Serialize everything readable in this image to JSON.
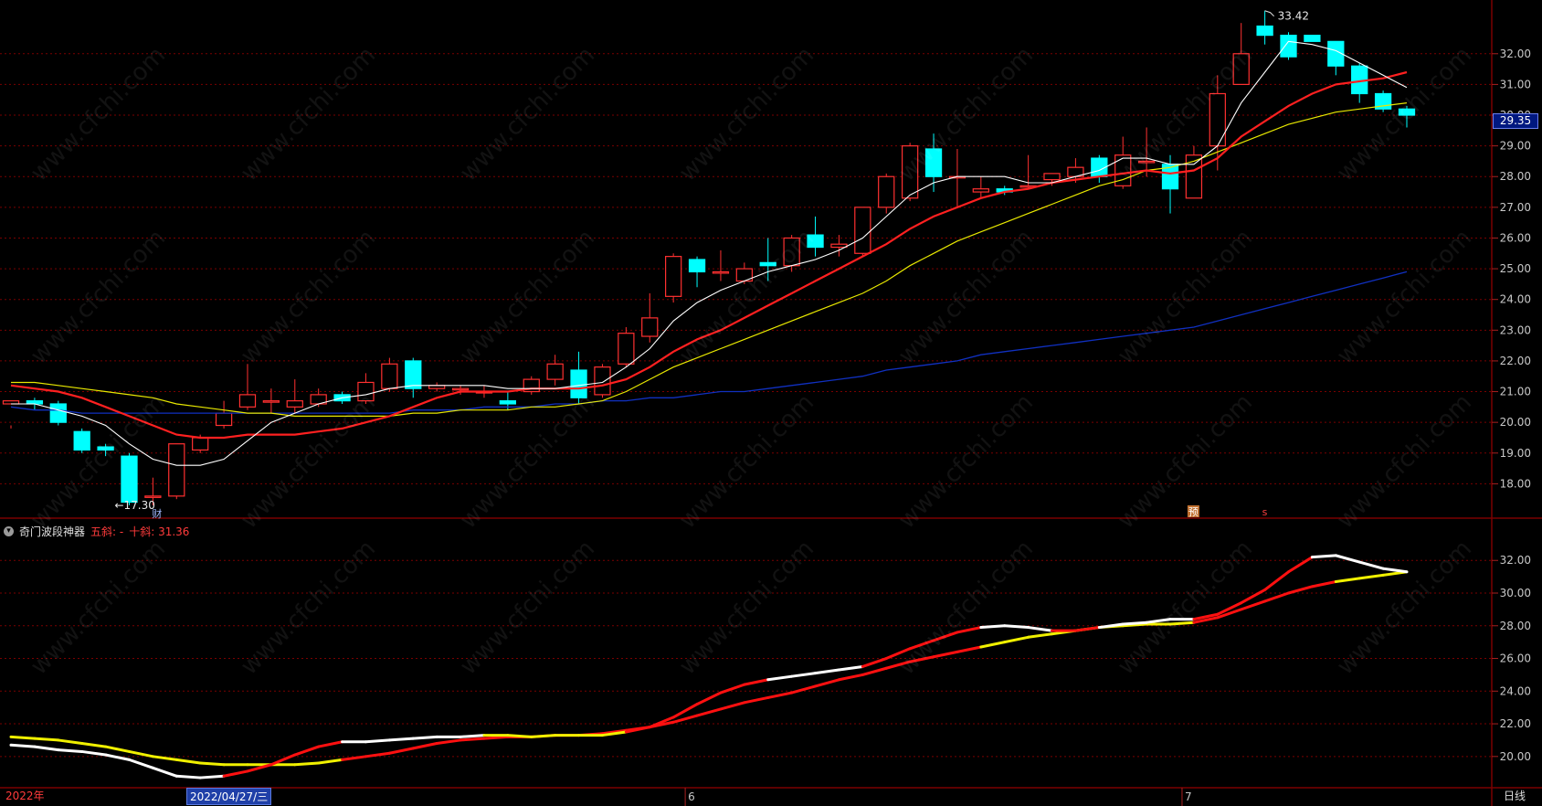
{
  "indicator": {
    "name": "奇门波段神器",
    "fast_label": "五斜: -",
    "slow_label": "十斜: 31.36"
  },
  "bottom_axis": {
    "start_label": "2022年",
    "cursor_date": "2022/04/27/三",
    "month_labels": [
      "6",
      "7"
    ],
    "period": "日线"
  },
  "current_price": "29.35",
  "watermark_text": "www.cfchi.com",
  "colors": {
    "up": "#ff3030",
    "down": "#00ffff",
    "ma5": "#ffffff",
    "ma10": "#ff2020",
    "ma20": "#e8e800",
    "ma60": "#1030c0",
    "grid": "#7a0000"
  },
  "chart_data": [
    {
      "type": "candlestick",
      "yticks": [
        "32.00",
        "31.00",
        "30.00",
        "29.00",
        "28.00",
        "27.00",
        "26.00",
        "25.00",
        "24.00",
        "23.00",
        "22.00",
        "21.00",
        "20.00",
        "19.00",
        "18.00"
      ],
      "ylim": [
        17.0,
        33.6
      ],
      "annotations": {
        "high_label": "33.42",
        "low_label": "17.30",
        "marker_cai": "财",
        "marker_yu": "预",
        "marker_s": "s"
      },
      "candles": [
        [
          20.6,
          20.7,
          19.8,
          19.9
        ],
        [
          20.7,
          20.6,
          20.4,
          20.8
        ],
        [
          20.6,
          20.0,
          19.9,
          20.7
        ],
        [
          19.7,
          19.1,
          19.0,
          19.8
        ],
        [
          19.2,
          19.1,
          18.9,
          19.3
        ],
        [
          18.9,
          17.4,
          17.3,
          19.0
        ],
        [
          17.6,
          17.6,
          17.3,
          18.2
        ],
        [
          17.6,
          19.3,
          17.5,
          19.3
        ],
        [
          19.1,
          19.5,
          19.0,
          19.6
        ],
        [
          19.9,
          20.3,
          19.8,
          20.7
        ],
        [
          20.5,
          20.9,
          20.4,
          21.9
        ],
        [
          20.7,
          20.7,
          20.3,
          21.1
        ],
        [
          20.5,
          20.7,
          20.3,
          21.4
        ],
        [
          20.6,
          20.9,
          20.5,
          21.1
        ],
        [
          20.9,
          20.7,
          20.6,
          21.0
        ],
        [
          20.7,
          21.3,
          20.6,
          21.6
        ],
        [
          21.1,
          21.9,
          21.0,
          22.1
        ],
        [
          22.0,
          21.1,
          20.8,
          22.1
        ],
        [
          21.1,
          21.2,
          21.0,
          21.3
        ],
        [
          21.1,
          21.1,
          20.9,
          21.2
        ],
        [
          21.0,
          21.0,
          20.8,
          21.2
        ],
        [
          20.7,
          20.6,
          20.4,
          21.0
        ],
        [
          21.0,
          21.4,
          20.9,
          21.5
        ],
        [
          21.4,
          21.9,
          21.2,
          22.2
        ],
        [
          21.7,
          20.8,
          20.6,
          22.3
        ],
        [
          20.9,
          21.8,
          20.8,
          21.9
        ],
        [
          21.9,
          22.9,
          21.8,
          23.1
        ],
        [
          22.8,
          23.4,
          22.6,
          24.2
        ],
        [
          24.1,
          25.4,
          23.9,
          25.5
        ],
        [
          25.3,
          24.9,
          24.4,
          25.4
        ],
        [
          24.9,
          24.9,
          24.6,
          25.6
        ],
        [
          24.6,
          25.0,
          24.5,
          25.2
        ],
        [
          25.2,
          25.1,
          24.6,
          26.0
        ],
        [
          25.1,
          26.0,
          24.9,
          26.1
        ],
        [
          26.1,
          25.7,
          25.4,
          26.7
        ],
        [
          25.7,
          25.8,
          25.4,
          26.1
        ],
        [
          25.5,
          27.0,
          25.4,
          27.0
        ],
        [
          27.0,
          28.0,
          26.8,
          28.1
        ],
        [
          27.3,
          29.0,
          27.2,
          29.1
        ],
        [
          28.9,
          28.0,
          27.5,
          29.4
        ],
        [
          28.0,
          28.0,
          27.0,
          28.9
        ],
        [
          27.5,
          27.6,
          27.3,
          28.0
        ],
        [
          27.6,
          27.5,
          27.4,
          27.7
        ],
        [
          27.7,
          27.7,
          27.6,
          28.7
        ],
        [
          27.9,
          28.1,
          27.7,
          28.1
        ],
        [
          28.0,
          28.3,
          27.8,
          28.6
        ],
        [
          28.6,
          28.0,
          27.8,
          28.7
        ],
        [
          27.7,
          28.7,
          27.6,
          29.3
        ],
        [
          28.5,
          28.5,
          28.0,
          29.6
        ],
        [
          28.4,
          27.6,
          26.8,
          28.7
        ],
        [
          27.3,
          28.7,
          27.3,
          29.0
        ],
        [
          29.0,
          30.7,
          28.2,
          31.3
        ],
        [
          31.0,
          32.0,
          31.2,
          33.0
        ],
        [
          32.9,
          32.6,
          32.3,
          33.4
        ],
        [
          32.6,
          31.9,
          31.8,
          32.7
        ],
        [
          32.6,
          32.4,
          32.4,
          32.6
        ],
        [
          32.4,
          31.6,
          31.3,
          32.4
        ],
        [
          31.6,
          30.7,
          30.4,
          31.7
        ],
        [
          30.7,
          30.2,
          30.1,
          30.8
        ],
        [
          30.2,
          30.0,
          29.6,
          30.3
        ]
      ],
      "ma5": [
        20.6,
        20.6,
        20.4,
        20.2,
        19.9,
        19.3,
        18.8,
        18.6,
        18.6,
        18.8,
        19.4,
        20.0,
        20.3,
        20.6,
        20.8,
        20.9,
        21.1,
        21.2,
        21.2,
        21.2,
        21.2,
        21.1,
        21.1,
        21.1,
        21.2,
        21.3,
        21.8,
        22.4,
        23.3,
        23.9,
        24.3,
        24.6,
        24.9,
        25.1,
        25.3,
        25.6,
        26.0,
        26.7,
        27.4,
        27.8,
        28.0,
        28.0,
        28.0,
        27.8,
        27.8,
        28.0,
        28.2,
        28.6,
        28.6,
        28.4,
        28.4,
        29.0,
        30.4,
        31.4,
        32.4,
        32.3,
        32.1,
        31.7,
        31.3,
        30.9
      ],
      "ma10": [
        21.2,
        21.1,
        21.0,
        20.8,
        20.5,
        20.2,
        19.9,
        19.6,
        19.5,
        19.5,
        19.6,
        19.6,
        19.6,
        19.7,
        19.8,
        20.0,
        20.2,
        20.5,
        20.8,
        21.0,
        21.0,
        21.0,
        21.1,
        21.1,
        21.1,
        21.2,
        21.4,
        21.8,
        22.3,
        22.7,
        23.0,
        23.4,
        23.8,
        24.2,
        24.6,
        25.0,
        25.4,
        25.8,
        26.3,
        26.7,
        27.0,
        27.3,
        27.5,
        27.6,
        27.8,
        27.9,
        28.0,
        28.1,
        28.2,
        28.1,
        28.2,
        28.6,
        29.3,
        29.8,
        30.3,
        30.7,
        31.0,
        31.1,
        31.2,
        31.4
      ],
      "ma20": [
        21.3,
        21.3,
        21.2,
        21.1,
        21.0,
        20.9,
        20.8,
        20.6,
        20.5,
        20.4,
        20.3,
        20.3,
        20.2,
        20.2,
        20.2,
        20.2,
        20.2,
        20.3,
        20.3,
        20.4,
        20.4,
        20.4,
        20.5,
        20.5,
        20.6,
        20.7,
        21.0,
        21.4,
        21.8,
        22.1,
        22.4,
        22.7,
        23.0,
        23.3,
        23.6,
        23.9,
        24.2,
        24.6,
        25.1,
        25.5,
        25.9,
        26.2,
        26.5,
        26.8,
        27.1,
        27.4,
        27.7,
        27.9,
        28.2,
        28.3,
        28.5,
        28.8,
        29.1,
        29.4,
        29.7,
        29.9,
        30.1,
        30.2,
        30.3,
        30.4
      ],
      "ma60": [
        20.5,
        20.4,
        20.4,
        20.3,
        20.3,
        20.3,
        20.3,
        20.3,
        20.3,
        20.3,
        20.3,
        20.3,
        20.3,
        20.3,
        20.3,
        20.3,
        20.3,
        20.4,
        20.4,
        20.4,
        20.5,
        20.5,
        20.5,
        20.6,
        20.6,
        20.7,
        20.7,
        20.8,
        20.8,
        20.9,
        21.0,
        21.0,
        21.1,
        21.2,
        21.3,
        21.4,
        21.5,
        21.7,
        21.8,
        21.9,
        22.0,
        22.2,
        22.3,
        22.4,
        22.5,
        22.6,
        22.7,
        22.8,
        22.9,
        23.0,
        23.1,
        23.3,
        23.5,
        23.7,
        23.9,
        24.1,
        24.3,
        24.5,
        24.7,
        24.9
      ]
    },
    {
      "type": "line",
      "name": "奇门波段神器",
      "yticks": [
        "32.00",
        "30.00",
        "28.00",
        "26.00",
        "24.00",
        "22.00",
        "20.00"
      ],
      "ylim": [
        18.2,
        33.3
      ],
      "fast": [
        20.7,
        20.6,
        20.4,
        20.3,
        20.1,
        19.8,
        19.3,
        18.8,
        18.7,
        18.8,
        19.1,
        19.5,
        20.1,
        20.6,
        20.9,
        20.9,
        21.0,
        21.1,
        21.2,
        21.2,
        21.3,
        21.3,
        21.2,
        21.3,
        21.3,
        21.3,
        21.5,
        21.8,
        22.4,
        23.2,
        23.9,
        24.4,
        24.7,
        24.9,
        25.1,
        25.3,
        25.5,
        26.0,
        26.6,
        27.1,
        27.6,
        27.9,
        28.0,
        27.9,
        27.7,
        27.7,
        27.9,
        28.1,
        28.2,
        28.4,
        28.4,
        28.7,
        29.4,
        30.2,
        31.3,
        32.2,
        32.3,
        31.9,
        31.5,
        31.3
      ],
      "slow": [
        21.2,
        21.1,
        21.0,
        20.8,
        20.6,
        20.3,
        20.0,
        19.8,
        19.6,
        19.5,
        19.5,
        19.5,
        19.5,
        19.6,
        19.8,
        20.0,
        20.2,
        20.5,
        20.8,
        21.0,
        21.1,
        21.2,
        21.2,
        21.3,
        21.3,
        21.4,
        21.6,
        21.8,
        22.1,
        22.5,
        22.9,
        23.3,
        23.6,
        23.9,
        24.3,
        24.7,
        25.0,
        25.4,
        25.8,
        26.1,
        26.4,
        26.7,
        27.0,
        27.3,
        27.5,
        27.7,
        27.9,
        28.0,
        28.1,
        28.1,
        28.2,
        28.5,
        29.0,
        29.5,
        30.0,
        30.4,
        30.7,
        30.9,
        31.1,
        31.3
      ],
      "fast_color_segments": [
        "w",
        "w",
        "w",
        "w",
        "w",
        "w",
        "w",
        "w",
        "w",
        "r",
        "r",
        "r",
        "r",
        "r",
        "w",
        "w",
        "w",
        "w",
        "w",
        "w",
        "y",
        "y",
        "y",
        "y",
        "y",
        "y",
        "r",
        "r",
        "r",
        "r",
        "r",
        "r",
        "w",
        "w",
        "w",
        "w",
        "r",
        "r",
        "r",
        "r",
        "r",
        "w",
        "w",
        "w",
        "r",
        "r",
        "w",
        "w",
        "w",
        "w",
        "r",
        "r",
        "r",
        "r",
        "r",
        "w",
        "w",
        "w",
        "w",
        "w"
      ],
      "slow_color_segments": [
        "y",
        "y",
        "y",
        "y",
        "y",
        "y",
        "y",
        "y",
        "y",
        "y",
        "y",
        "y",
        "y",
        "y",
        "r",
        "r",
        "r",
        "r",
        "r",
        "r",
        "r",
        "r",
        "r",
        "r",
        "r",
        "r",
        "r",
        "r",
        "r",
        "r",
        "r",
        "r",
        "r",
        "r",
        "r",
        "r",
        "r",
        "r",
        "r",
        "r",
        "r",
        "y",
        "y",
        "y",
        "y",
        "y",
        "y",
        "y",
        "y",
        "y",
        "r",
        "r",
        "r",
        "r",
        "r",
        "r",
        "y",
        "y",
        "y",
        "y"
      ]
    }
  ]
}
